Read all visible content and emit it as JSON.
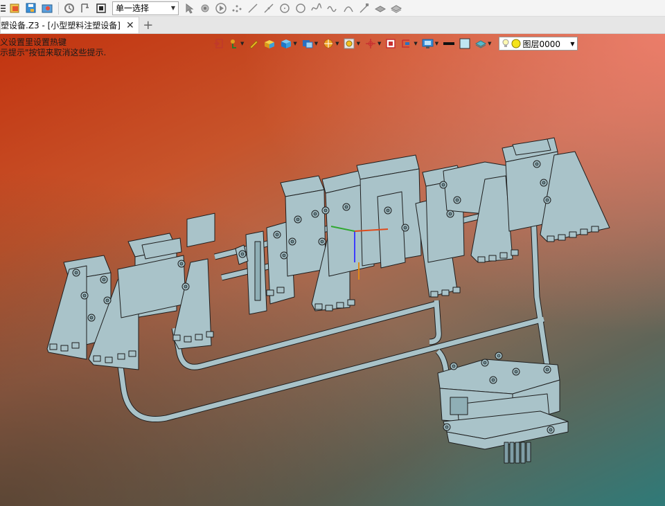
{
  "toolbar": {
    "icons": [
      "menu-icon",
      "open-file-icon",
      "save-icon",
      "settings-icon",
      "rotate-icon",
      "pick-filter-icon",
      "stop-icon",
      "cursor-icon",
      "pick-point-icon",
      "play-icon",
      "points-icon",
      "line-icon",
      "line2-icon",
      "circle-icon",
      "circle2-icon",
      "spline-icon",
      "wave-icon",
      "arc-icon",
      "trim-icon",
      "surface-icon",
      "surface2-icon"
    ],
    "select_value": "单一选择"
  },
  "tabs": [
    {
      "label": "塑设备.Z3 - [小型塑料注塑设备]",
      "close": "✕"
    }
  ],
  "tab_add": "+",
  "viewport": {
    "hints": [
      "义设置里设置热键",
      "示提示\"按钮来取消这些提示."
    ],
    "layer": "图层0000",
    "colors": {
      "part_fill": "#a9c3c9",
      "part_edge": "#1d1d1d"
    }
  }
}
